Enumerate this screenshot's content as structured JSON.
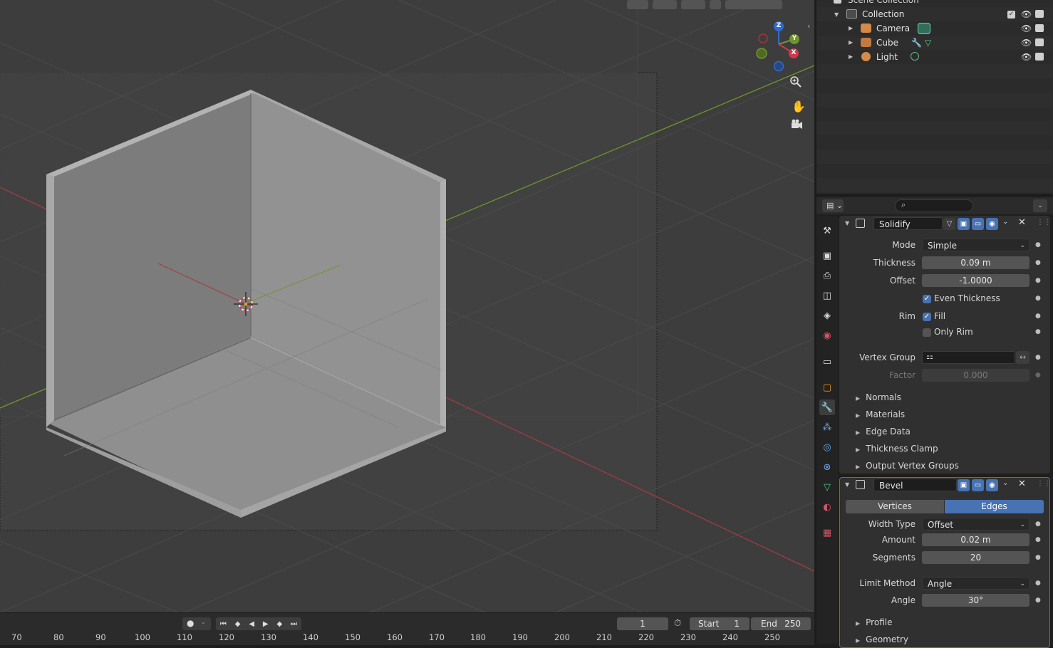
{
  "outliner": {
    "top_label": "Scene Collection",
    "collection_label": "Collection",
    "items": [
      {
        "label": "Camera"
      },
      {
        "label": "Cube"
      },
      {
        "label": "Light"
      }
    ]
  },
  "viewport": {
    "gizmo_axes": {
      "z": "Z",
      "y": "Y",
      "x": "X"
    }
  },
  "timeline": {
    "current_frame": "1",
    "start_label": "Start",
    "start_value": "1",
    "end_label": "End",
    "end_value": "250",
    "frame_numbers": [
      "70",
      "80",
      "90",
      "100",
      "110",
      "120",
      "130",
      "140",
      "150",
      "160",
      "170",
      "180",
      "190",
      "200",
      "210",
      "220",
      "230",
      "240",
      "250"
    ]
  },
  "properties": {
    "search_placeholder": "",
    "solidify": {
      "name": "Solidify",
      "mode_label": "Mode",
      "mode_value": "Simple",
      "thickness_label": "Thickness",
      "thickness_value": "0.09 m",
      "offset_label": "Offset",
      "offset_value": "-1.0000",
      "even_thickness_label": "Even Thickness",
      "rim_label": "Rim",
      "fill_label": "Fill",
      "only_rim_label": "Only Rim",
      "vertex_group_label": "Vertex Group",
      "factor_label": "Factor",
      "factor_value": "0.000",
      "subpanels": [
        "Normals",
        "Materials",
        "Edge Data",
        "Thickness Clamp",
        "Output Vertex Groups"
      ]
    },
    "bevel": {
      "name": "Bevel",
      "vertices_label": "Vertices",
      "edges_label": "Edges",
      "width_type_label": "Width Type",
      "width_type_value": "Offset",
      "amount_label": "Amount",
      "amount_value": "0.02 m",
      "segments_label": "Segments",
      "segments_value": "20",
      "limit_method_label": "Limit Method",
      "limit_method_value": "Angle",
      "angle_label": "Angle",
      "angle_value": "30°",
      "subpanels": [
        "Profile",
        "Geometry"
      ]
    }
  }
}
